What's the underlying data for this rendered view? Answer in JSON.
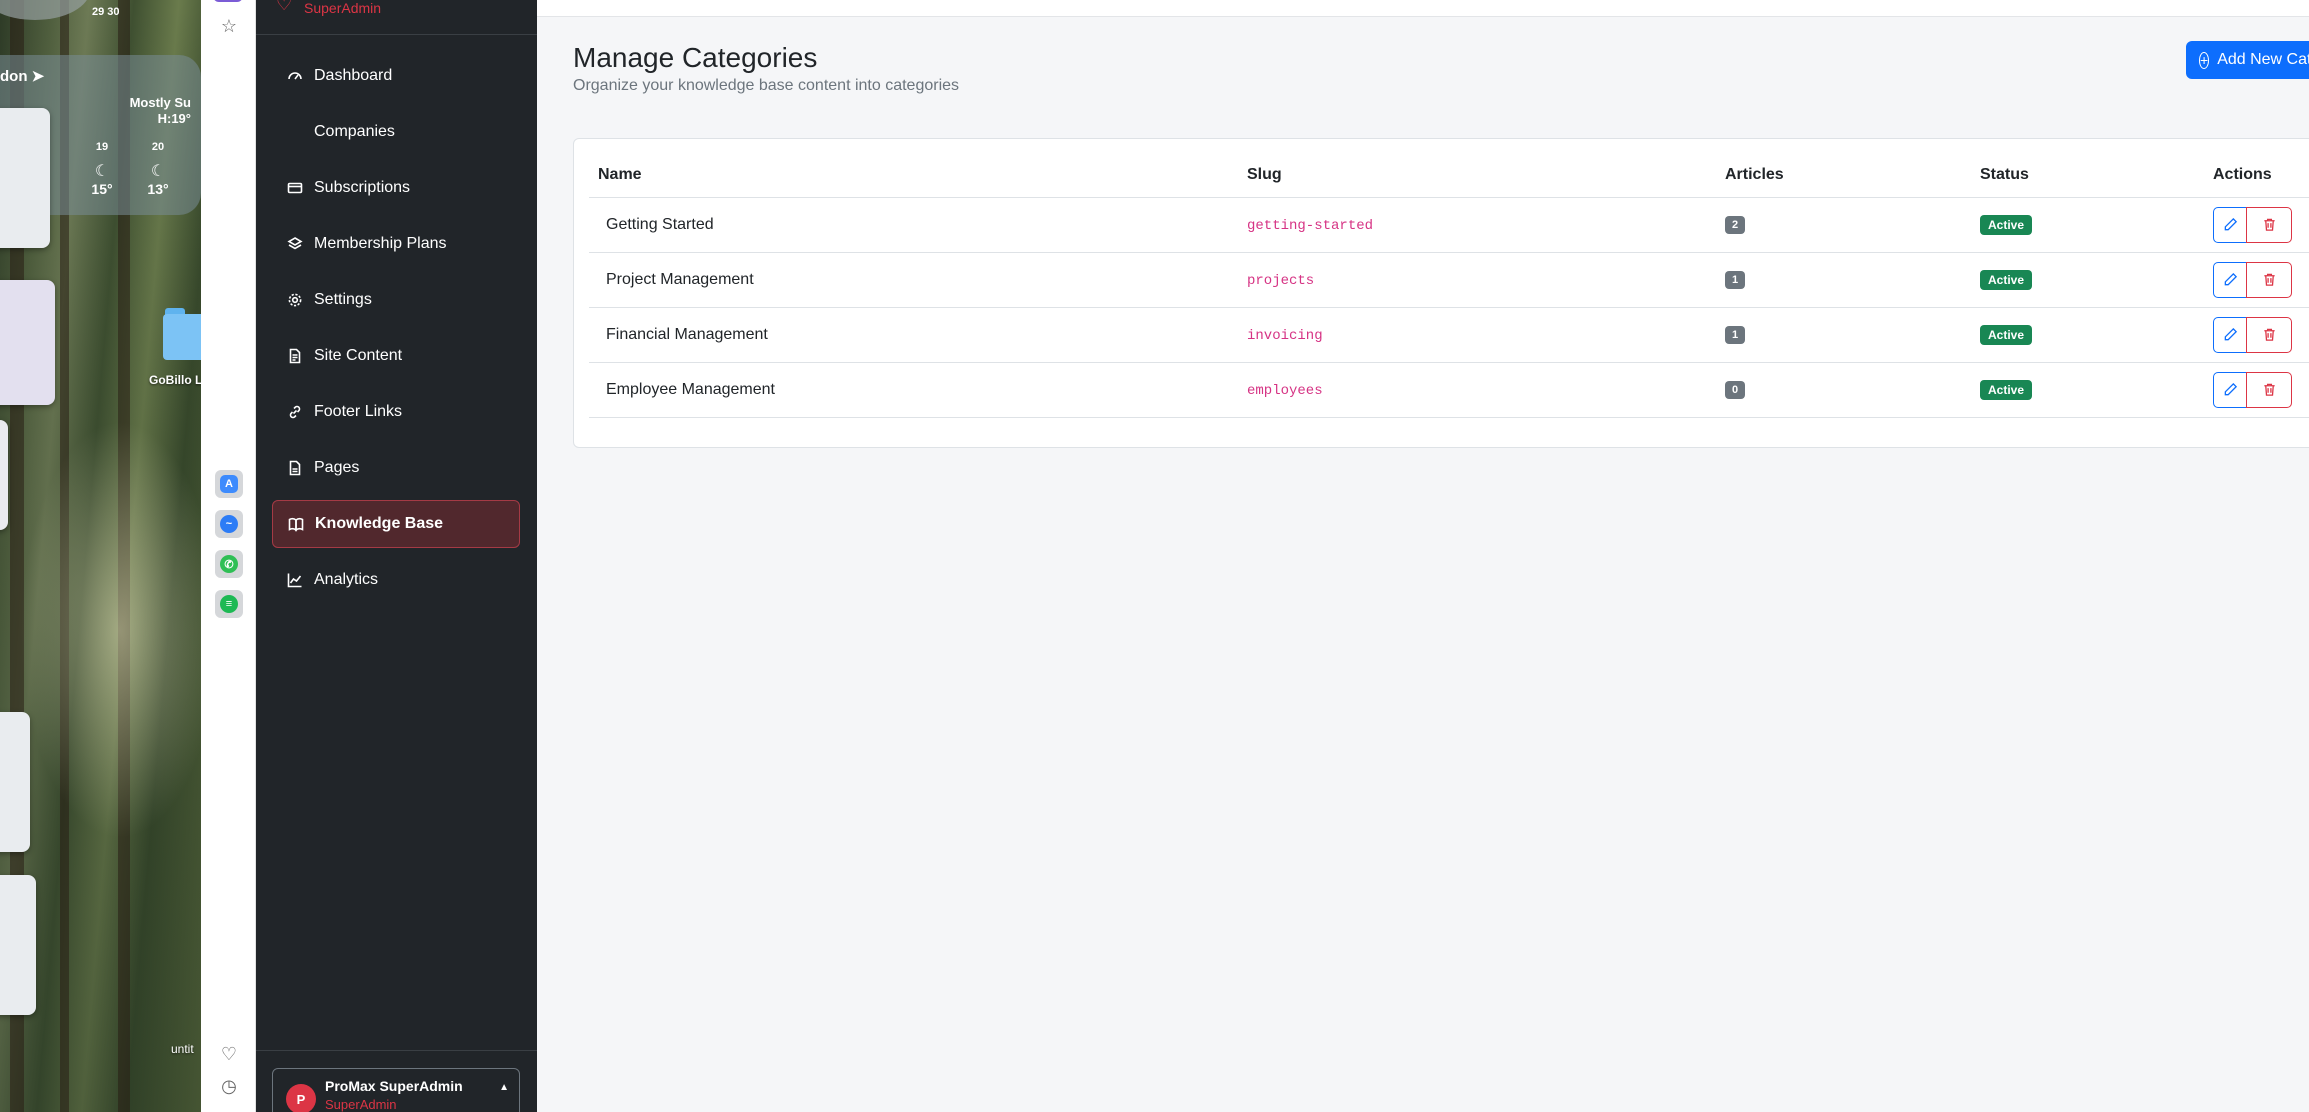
{
  "desktop": {
    "calendar_days": "29  30",
    "weather_city": "don ➤",
    "weather_condition": "Mostly Su",
    "weather_high": "H:19°",
    "hours": [
      "19",
      "20"
    ],
    "temps": [
      "15°",
      "13°"
    ],
    "folder_label": "GoBillo L",
    "untitled_label": "untit"
  },
  "brand": {
    "role": "SuperAdmin"
  },
  "sidebar": {
    "items": [
      {
        "label": "Dashboard",
        "icon": "speedometer-icon"
      },
      {
        "label": "Companies",
        "icon": "building-icon"
      },
      {
        "label": "Subscriptions",
        "icon": "credit-card-icon"
      },
      {
        "label": "Membership Plans",
        "icon": "layers-icon"
      },
      {
        "label": "Settings",
        "icon": "gear-icon"
      },
      {
        "label": "Site Content",
        "icon": "file-text-icon"
      },
      {
        "label": "Footer Links",
        "icon": "link-icon"
      },
      {
        "label": "Pages",
        "icon": "file-icon"
      },
      {
        "label": "Knowledge Base",
        "icon": "book-icon",
        "active": true
      },
      {
        "label": "Analytics",
        "icon": "graph-icon"
      }
    ]
  },
  "user": {
    "initial": "P",
    "name": "ProMax SuperAdmin",
    "role": "SuperAdmin"
  },
  "page": {
    "title": "Manage Categories",
    "subtitle": "Organize your knowledge base content into categories",
    "add_button": "Add New Category"
  },
  "table": {
    "headers": [
      "Name",
      "Slug",
      "Articles",
      "Status",
      "Actions"
    ],
    "rows": [
      {
        "name": "Getting Started",
        "slug": "getting-started",
        "articles": "2",
        "status": "Active"
      },
      {
        "name": "Project Management",
        "slug": "projects",
        "articles": "1",
        "status": "Active"
      },
      {
        "name": "Financial Management",
        "slug": "invoicing",
        "articles": "1",
        "status": "Active"
      },
      {
        "name": "Employee Management",
        "slug": "employees",
        "articles": "0",
        "status": "Active"
      }
    ]
  },
  "colors": {
    "primary": "#0d6efd",
    "danger": "#dc3545",
    "success": "#198754",
    "sidebar_bg": "#212529",
    "slug_text": "#d63384"
  }
}
